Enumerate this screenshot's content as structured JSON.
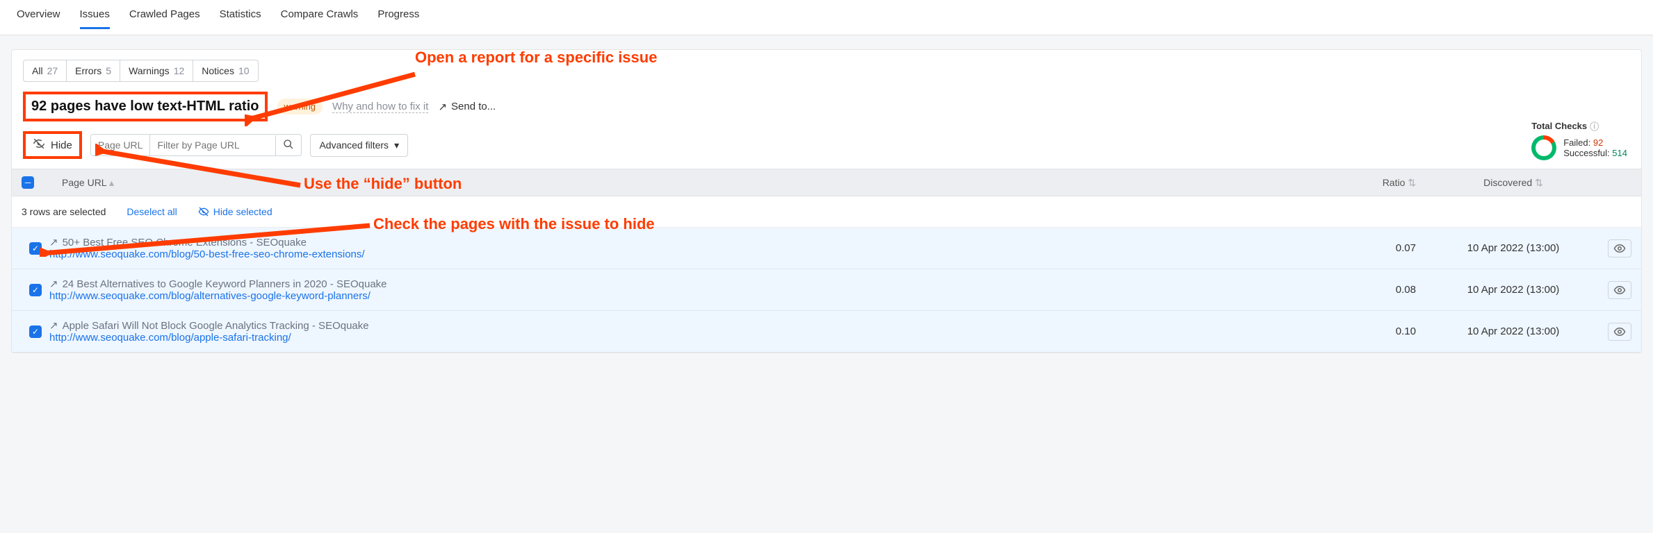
{
  "tabs": {
    "items": [
      "Overview",
      "Issues",
      "Crawled Pages",
      "Statistics",
      "Compare Crawls",
      "Progress"
    ],
    "active": 1
  },
  "filters": [
    {
      "label": "All",
      "count": "27"
    },
    {
      "label": "Errors",
      "count": "5"
    },
    {
      "label": "Warnings",
      "count": "12"
    },
    {
      "label": "Notices",
      "count": "10"
    }
  ],
  "issue": {
    "title": "92 pages have low text-HTML ratio",
    "badge": "warning",
    "fix_link": "Why and how to fix it",
    "send_to": "Send to..."
  },
  "controls": {
    "hide": "Hide",
    "input_label": "Page URL",
    "input_placeholder": "Filter by Page URL",
    "advanced": "Advanced filters"
  },
  "totals": {
    "title": "Total Checks",
    "failed_label": "Failed:",
    "failed": "92",
    "success_label": "Successful:",
    "success": "514"
  },
  "columns": {
    "url": "Page URL",
    "ratio": "Ratio",
    "discovered": "Discovered"
  },
  "selection": {
    "text": "3 rows are selected",
    "deselect": "Deselect all",
    "hide_selected": "Hide selected"
  },
  "rows": [
    {
      "title": "50+ Best Free SEO Chrome Extensions - SEOquake",
      "url": "http://www.seoquake.com/blog/50-best-free-seo-chrome-extensions/",
      "ratio": "0.07",
      "discovered": "10 Apr 2022 (13:00)"
    },
    {
      "title": "24 Best Alternatives to Google Keyword Planners in 2020 - SEOquake",
      "url": "http://www.seoquake.com/blog/alternatives-google-keyword-planners/",
      "ratio": "0.08",
      "discovered": "10 Apr 2022 (13:00)"
    },
    {
      "title": "Apple Safari Will Not Block Google Analytics Tracking - SEOquake",
      "url": "http://www.seoquake.com/blog/apple-safari-tracking/",
      "ratio": "0.10",
      "discovered": "10 Apr 2022 (13:00)"
    }
  ],
  "annotations": {
    "a1": "Open a report for a specific issue",
    "a2": "Use the “hide” button",
    "a3": "Check the pages with the issue to hide"
  }
}
